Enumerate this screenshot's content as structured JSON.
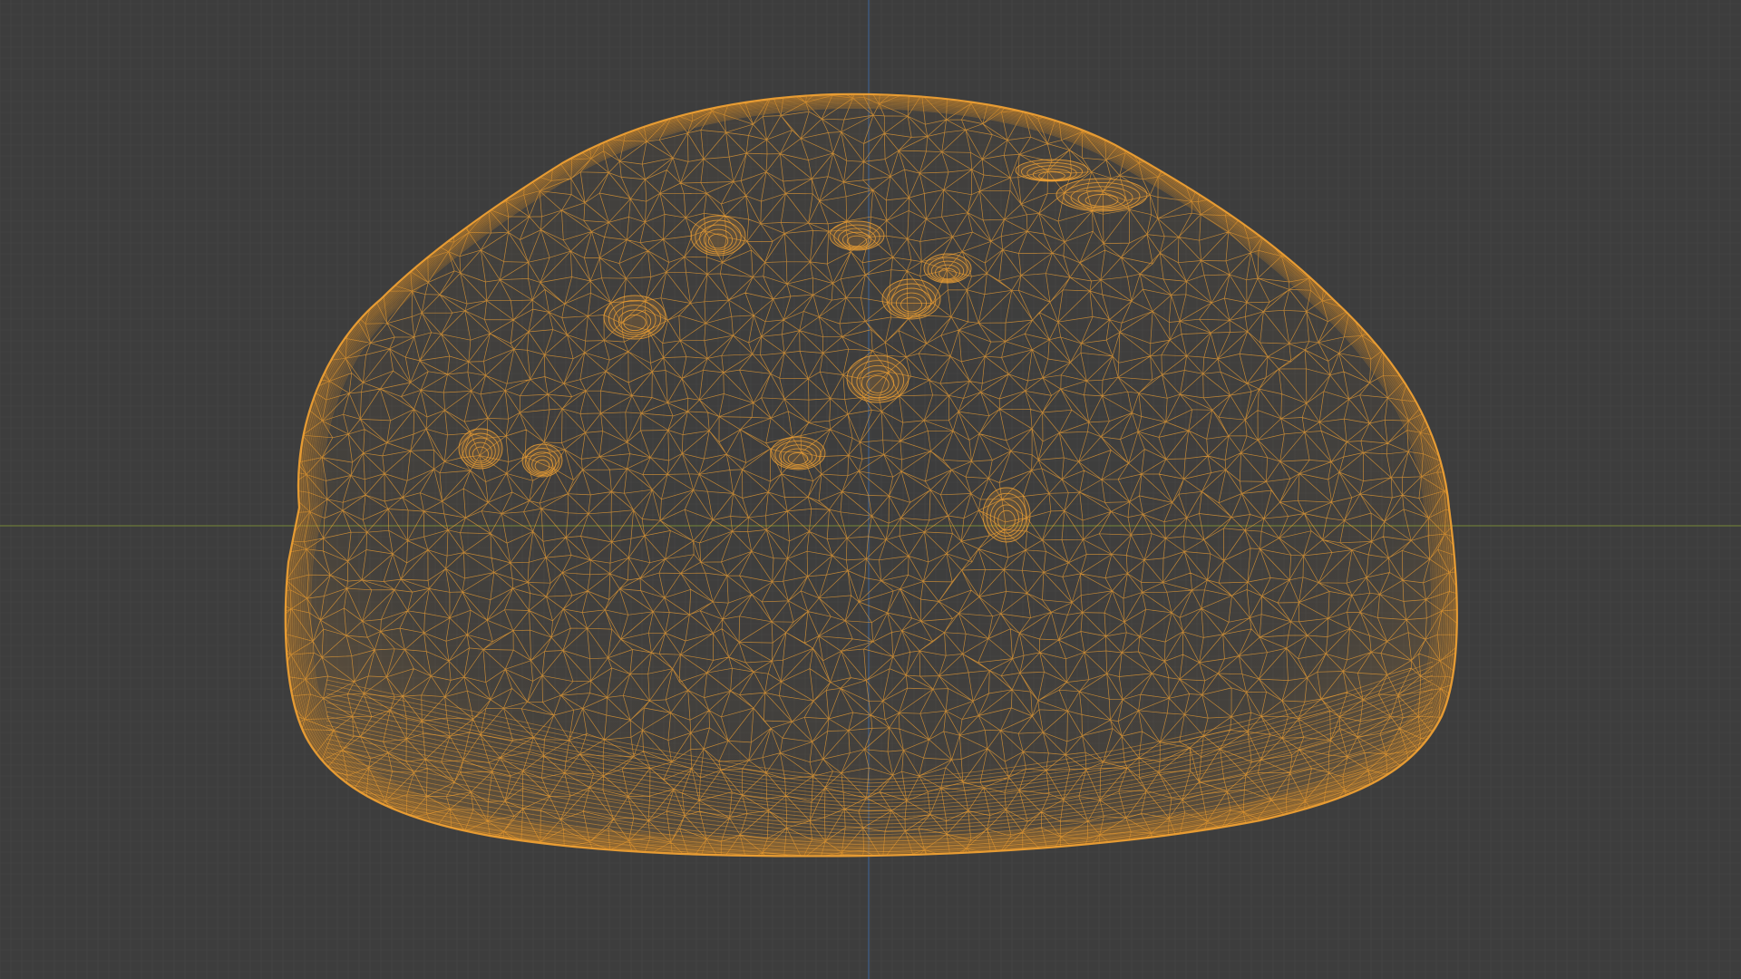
{
  "viewport": {
    "background_color": "#3d3d3d",
    "grid_minor_color": "#474747",
    "grid_major_color": "#4e4e4e",
    "axis_x_color": "#6b7a3a",
    "axis_z_color": "#3f5f8a",
    "wire_color": "#f2a233",
    "wire_dark_color": "#b8731d"
  },
  "object": {
    "label": "",
    "display_mode": "wireframe",
    "selected": true
  }
}
